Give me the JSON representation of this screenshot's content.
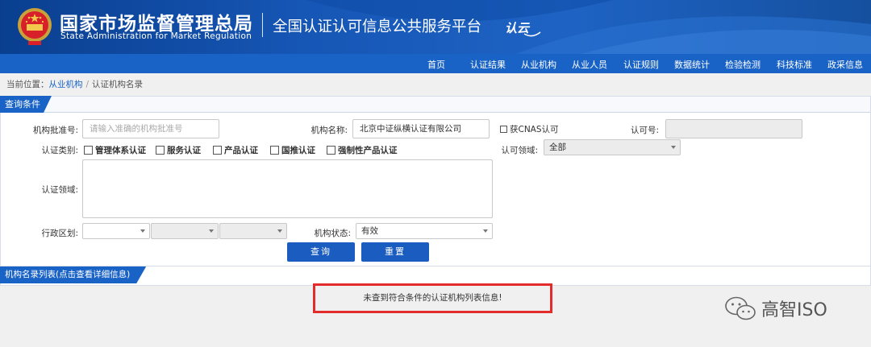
{
  "header": {
    "org_name_cn": "国家市场监督管理总局",
    "org_name_en": "State Administration  for  Market Regulation",
    "platform_title": "全国认证认可信息公共服务平台",
    "logo_mark_text": "认云"
  },
  "nav": {
    "items": [
      {
        "label": "首页"
      },
      {
        "label": "认证结果"
      },
      {
        "label": "从业机构"
      },
      {
        "label": "从业人员"
      },
      {
        "label": "认证规则"
      },
      {
        "label": "数据统计"
      },
      {
        "label": "检验检测"
      },
      {
        "label": "科技标准"
      },
      {
        "label": "政采信息"
      }
    ]
  },
  "breadcrumb": {
    "prefix": "当前位置：",
    "parent": "从业机构",
    "separator": "/",
    "current": "认证机构名录"
  },
  "query": {
    "title": "查询条件",
    "approval_no_label": "机构批准号:",
    "approval_no_placeholder": "请输入准确的机构批准号",
    "org_name_label": "机构名称:",
    "org_name_value": "北京中证纵横认证有限公司",
    "cnas_label": "获CNAS认可",
    "accreditation_no_label": "认可号:",
    "accreditation_no_value": "",
    "cert_type_label": "认证类别:",
    "cert_types": [
      {
        "label": "管理体系认证"
      },
      {
        "label": "服务认证"
      },
      {
        "label": "产品认证"
      },
      {
        "label": "国推认证"
      },
      {
        "label": "强制性产品认证"
      }
    ],
    "accreditation_field_label": "认可领域:",
    "accreditation_field_value": "全部",
    "cert_field_label": "认证领域:",
    "region_label": "行政区划:",
    "status_label": "机构状态:",
    "status_value": "有效",
    "search_button": "查询",
    "reset_button": "重置"
  },
  "list": {
    "title": "机构名录列表(点击查看详细信息)",
    "empty_message": "未查到符合条件的认证机构列表信息!"
  },
  "watermark": {
    "text": "高智ISO"
  },
  "colors": {
    "primary": "#1a63c6",
    "header_dark": "#0a3f8f",
    "highlight_border": "#e32b2b"
  }
}
